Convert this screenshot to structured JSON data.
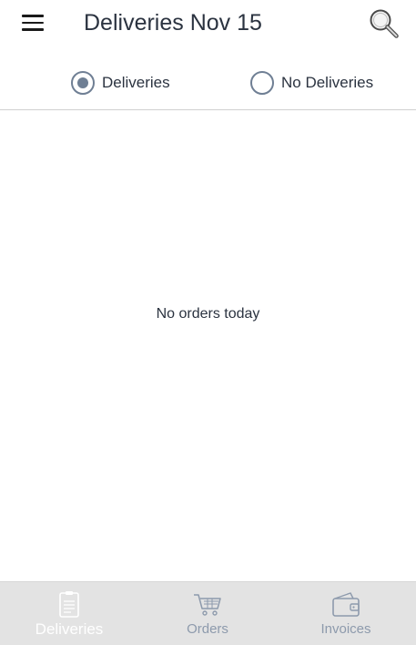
{
  "header": {
    "title": "Deliveries Nov 15"
  },
  "filter": {
    "options": [
      {
        "label": "Deliveries",
        "selected": true
      },
      {
        "label": "No Deliveries",
        "selected": false
      }
    ]
  },
  "main": {
    "empty_message": "No orders today"
  },
  "bottom_nav": {
    "items": [
      {
        "label": "Deliveries",
        "icon": "clipboard-icon",
        "active": true
      },
      {
        "label": "Orders",
        "icon": "cart-icon",
        "active": false
      },
      {
        "label": "Invoices",
        "icon": "wallet-icon",
        "active": false
      }
    ]
  },
  "colors": {
    "accent": "#6f7f94",
    "text": "#2b3340",
    "nav_bg": "#e3e3e3",
    "nav_inactive": "#8d9aac",
    "nav_active": "#ffffff"
  }
}
